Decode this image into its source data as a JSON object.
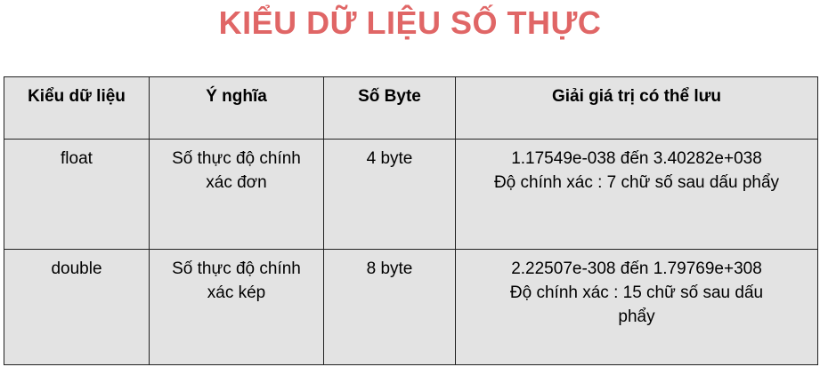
{
  "title": "KIỂU DỮ LIỆU SỐ THỰC",
  "colors": {
    "title": "#e06666",
    "table_bg": "#e3e3e3",
    "border": "#222222"
  },
  "table": {
    "headers": [
      "Kiểu dữ liệu",
      "Ý nghĩa",
      "Số Byte",
      "Giải giá trị có thể lưu"
    ],
    "rows": [
      {
        "type": "float",
        "meaning": [
          "Số thực độ chính",
          "xác đơn"
        ],
        "bytes": "4 byte",
        "range": [
          "1.17549e-038 đến 3.40282e+038",
          "Độ chính xác : 7 chữ số sau dấu phẩy"
        ]
      },
      {
        "type": "double",
        "meaning": [
          "Số thực độ chính",
          "xác kép"
        ],
        "bytes": "8 byte",
        "range": [
          "2.22507e-308 đến 1.79769e+308",
          "Độ chính xác : 15 chữ số sau dấu",
          "phẩy"
        ]
      }
    ]
  }
}
